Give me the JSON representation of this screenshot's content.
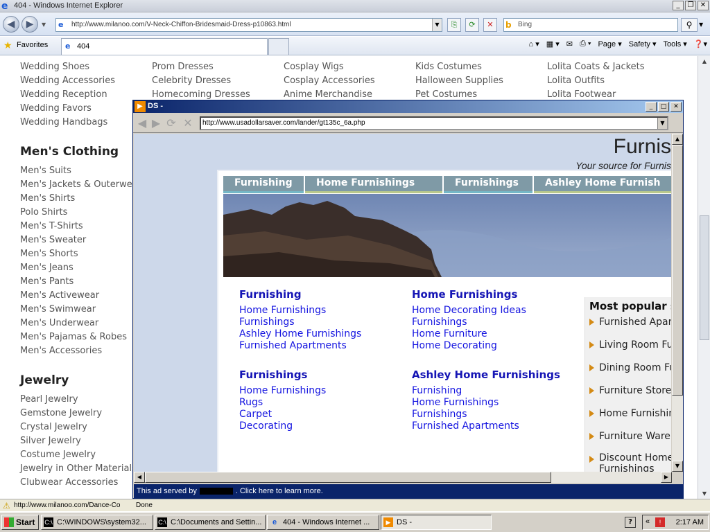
{
  "ie": {
    "title": "404 - Windows Internet Explorer",
    "address_url": "http://www.milanoo.com/V-Neck-Chiffon-Bridesmaid-Dress-p10863.html",
    "search_placeholder": "Bing",
    "favorites_label": "Favorites",
    "tab_label": "404",
    "commands": {
      "page": "Page ▾",
      "safety": "Safety ▾",
      "tools": "Tools ▾"
    },
    "status_url": "http://www.milanoo.com/Dance-Co",
    "status_done": "Done"
  },
  "bgpage": {
    "col1_top": [
      "Wedding Shoes",
      "Wedding Accessories",
      "Wedding Reception",
      "Wedding Favors",
      "Wedding Handbags"
    ],
    "col2_top": [
      "Prom Dresses",
      "Celebrity Dresses",
      "Homecoming Dresses"
    ],
    "col3_top": [
      "Cosplay Wigs",
      "Cosplay Accessories",
      "Anime Merchandise"
    ],
    "col4_top": [
      "Kids Costumes",
      "Halloween Supplies",
      "Pet Costumes"
    ],
    "col5_top": [
      "Lolita Coats & Jackets",
      "Lolita Outfits",
      "Lolita Footwear"
    ],
    "mens_heading": "Men's Clothing",
    "mens_items": [
      "Men's Suits",
      "Men's Jackets & Outerwear",
      "Men's Shirts",
      "Polo Shirts",
      "Men's T-Shirts",
      "Men's Sweater",
      "Men's Shorts",
      "Men's Jeans",
      "Men's Pants",
      "Men's Activewear",
      "Men's Swimwear",
      "Men's Underwear",
      "Men's Pajamas & Robes",
      "Men's Accessories"
    ],
    "jewelry_heading": "Jewelry",
    "jewelry_items": [
      "Pearl Jewelry",
      "Gemstone Jewelry",
      "Crystal Jewelry",
      "Silver Jewelry",
      "Costume Jewelry",
      "Jewelry in Other Materials",
      "Clubwear Accessories"
    ]
  },
  "popup": {
    "title": "DS -",
    "url": "http://www.usadollarsaver.com/lander/gt135c_6a.php",
    "site_title": "Furnis",
    "site_tagline": "Your source for Furnis",
    "nav_tabs": [
      "Furnishing",
      "Home Furnishings",
      "Furnishings",
      "Ashley Home Furnish"
    ],
    "col_a1": {
      "heading": "Furnishing",
      "links": [
        "Home Furnishings",
        "Furnishings",
        "Ashley Home Furnishings",
        "Furnished Apartments"
      ]
    },
    "col_b1": {
      "heading": "Home Furnishings",
      "links": [
        "Home Decorating Ideas",
        "Furnishings",
        "Home Furniture",
        "Home Decorating"
      ]
    },
    "col_a2": {
      "heading": "Furnishings",
      "links": [
        "Home Furnishings",
        "Rugs",
        "Carpet",
        "Decorating"
      ]
    },
    "col_b2": {
      "heading": "Ashley Home Furnishings",
      "links": [
        "Furnishing",
        "Home Furnishings",
        "Furnishings",
        "Furnished Apartments"
      ]
    },
    "popular_heading": "Most popular s",
    "popular_items": [
      "Furnished Apar",
      "Living Room Fu",
      "Dining Room Fu",
      "Furniture Store",
      "Home Furnishin",
      "Furniture Ware",
      "Discount Home Furnishings"
    ],
    "ad_prefix": "This ad served by",
    "ad_suffix": ". Click here to learn more."
  },
  "taskbar": {
    "start": "Start",
    "tasks": [
      "C:\\WINDOWS\\system32...",
      "C:\\Documents and Settin...",
      "404 - Windows Internet ...",
      "DS -"
    ],
    "clock": "2:17 AM"
  }
}
